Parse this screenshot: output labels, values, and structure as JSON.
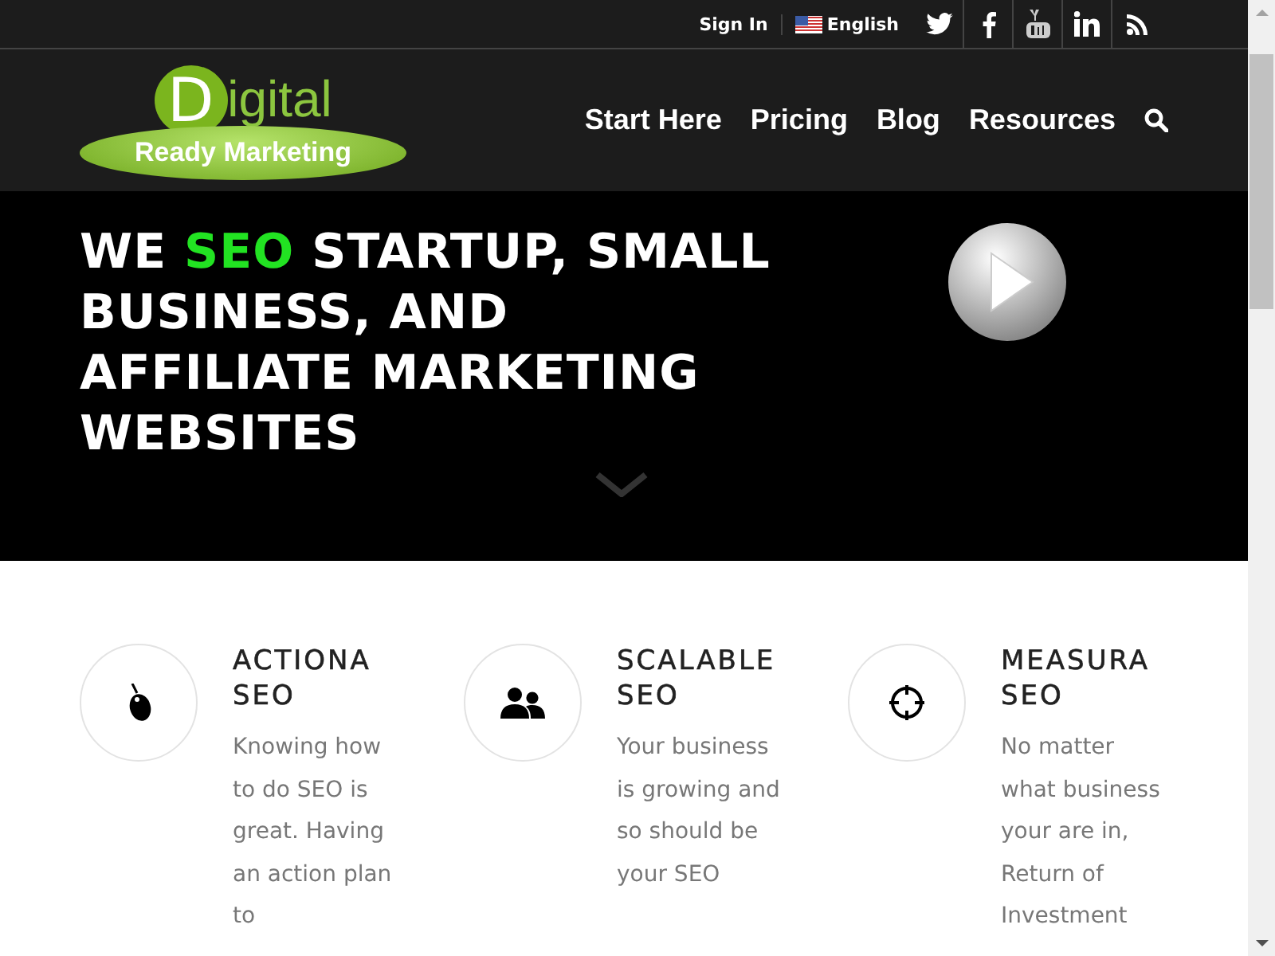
{
  "top_bar": {
    "sign_in": "Sign In",
    "language": "English",
    "social": [
      {
        "kind": "twitter"
      },
      {
        "kind": "facebook"
      },
      {
        "kind": "youtube"
      },
      {
        "kind": "linkedin"
      },
      {
        "kind": "rss"
      }
    ]
  },
  "logo": {
    "letter": "D",
    "word": "igital",
    "tagline": "Ready Marketing"
  },
  "nav": {
    "items": [
      "Start Here",
      "Pricing",
      "Blog",
      "Resources"
    ]
  },
  "hero": {
    "headline_start": "WE",
    "headline_highlight": "SEO",
    "headline_end": "STARTUP, SMALL BUSINESS, AND AFFILIATE MARKETING WEBSITES"
  },
  "features": [
    {
      "kind": "mouse",
      "title_line_1": "ACTIONA",
      "title_line_2": "SEO",
      "text": "Knowing how to do SEO is great. Having an action plan to"
    },
    {
      "kind": "people",
      "title_line_1": "SCALABLE",
      "title_line_2": "SEO",
      "text": "Your business is growing and so should be your SEO"
    },
    {
      "kind": "crosshair",
      "title_line_1": "MEASURA",
      "title_line_2": "SEO",
      "text": "No matter what business your are in, Return of Investment"
    }
  ]
}
